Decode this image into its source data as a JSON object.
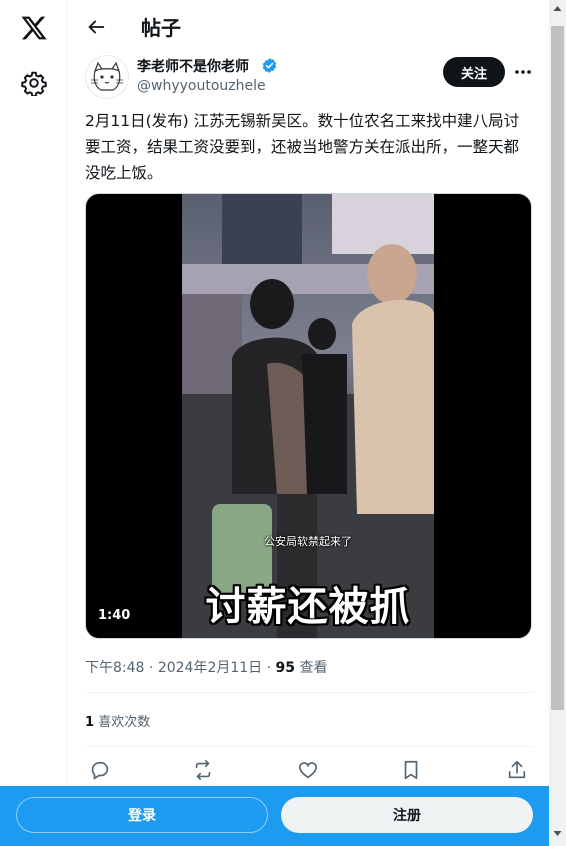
{
  "header": {
    "title": "帖子"
  },
  "post": {
    "author_name": "李老师不是你老师",
    "author_handle": "@whyyoutouzhele",
    "follow_label": "关注",
    "text": "2月11日(发布) 江苏无锡新吴区。数十位农名工来找中建八局讨要工资，结果工资没要到，还被当地警方关在派出所，一整天都没吃上饭。",
    "video": {
      "duration": "1:40",
      "subtitle_small": "公安局软禁起来了",
      "subtitle_big": "讨薪还被抓"
    },
    "time": "下午8:48",
    "date": "2024年2月11日",
    "views_count": "95",
    "views_label": "查看",
    "likes_count": "1",
    "likes_label": "喜欢次数"
  },
  "bottom_bar": {
    "login_label": "登录",
    "signup_label": "注册"
  },
  "colors": {
    "accent": "#1d9bf0",
    "text": "#0f1419",
    "muted": "#536471"
  }
}
